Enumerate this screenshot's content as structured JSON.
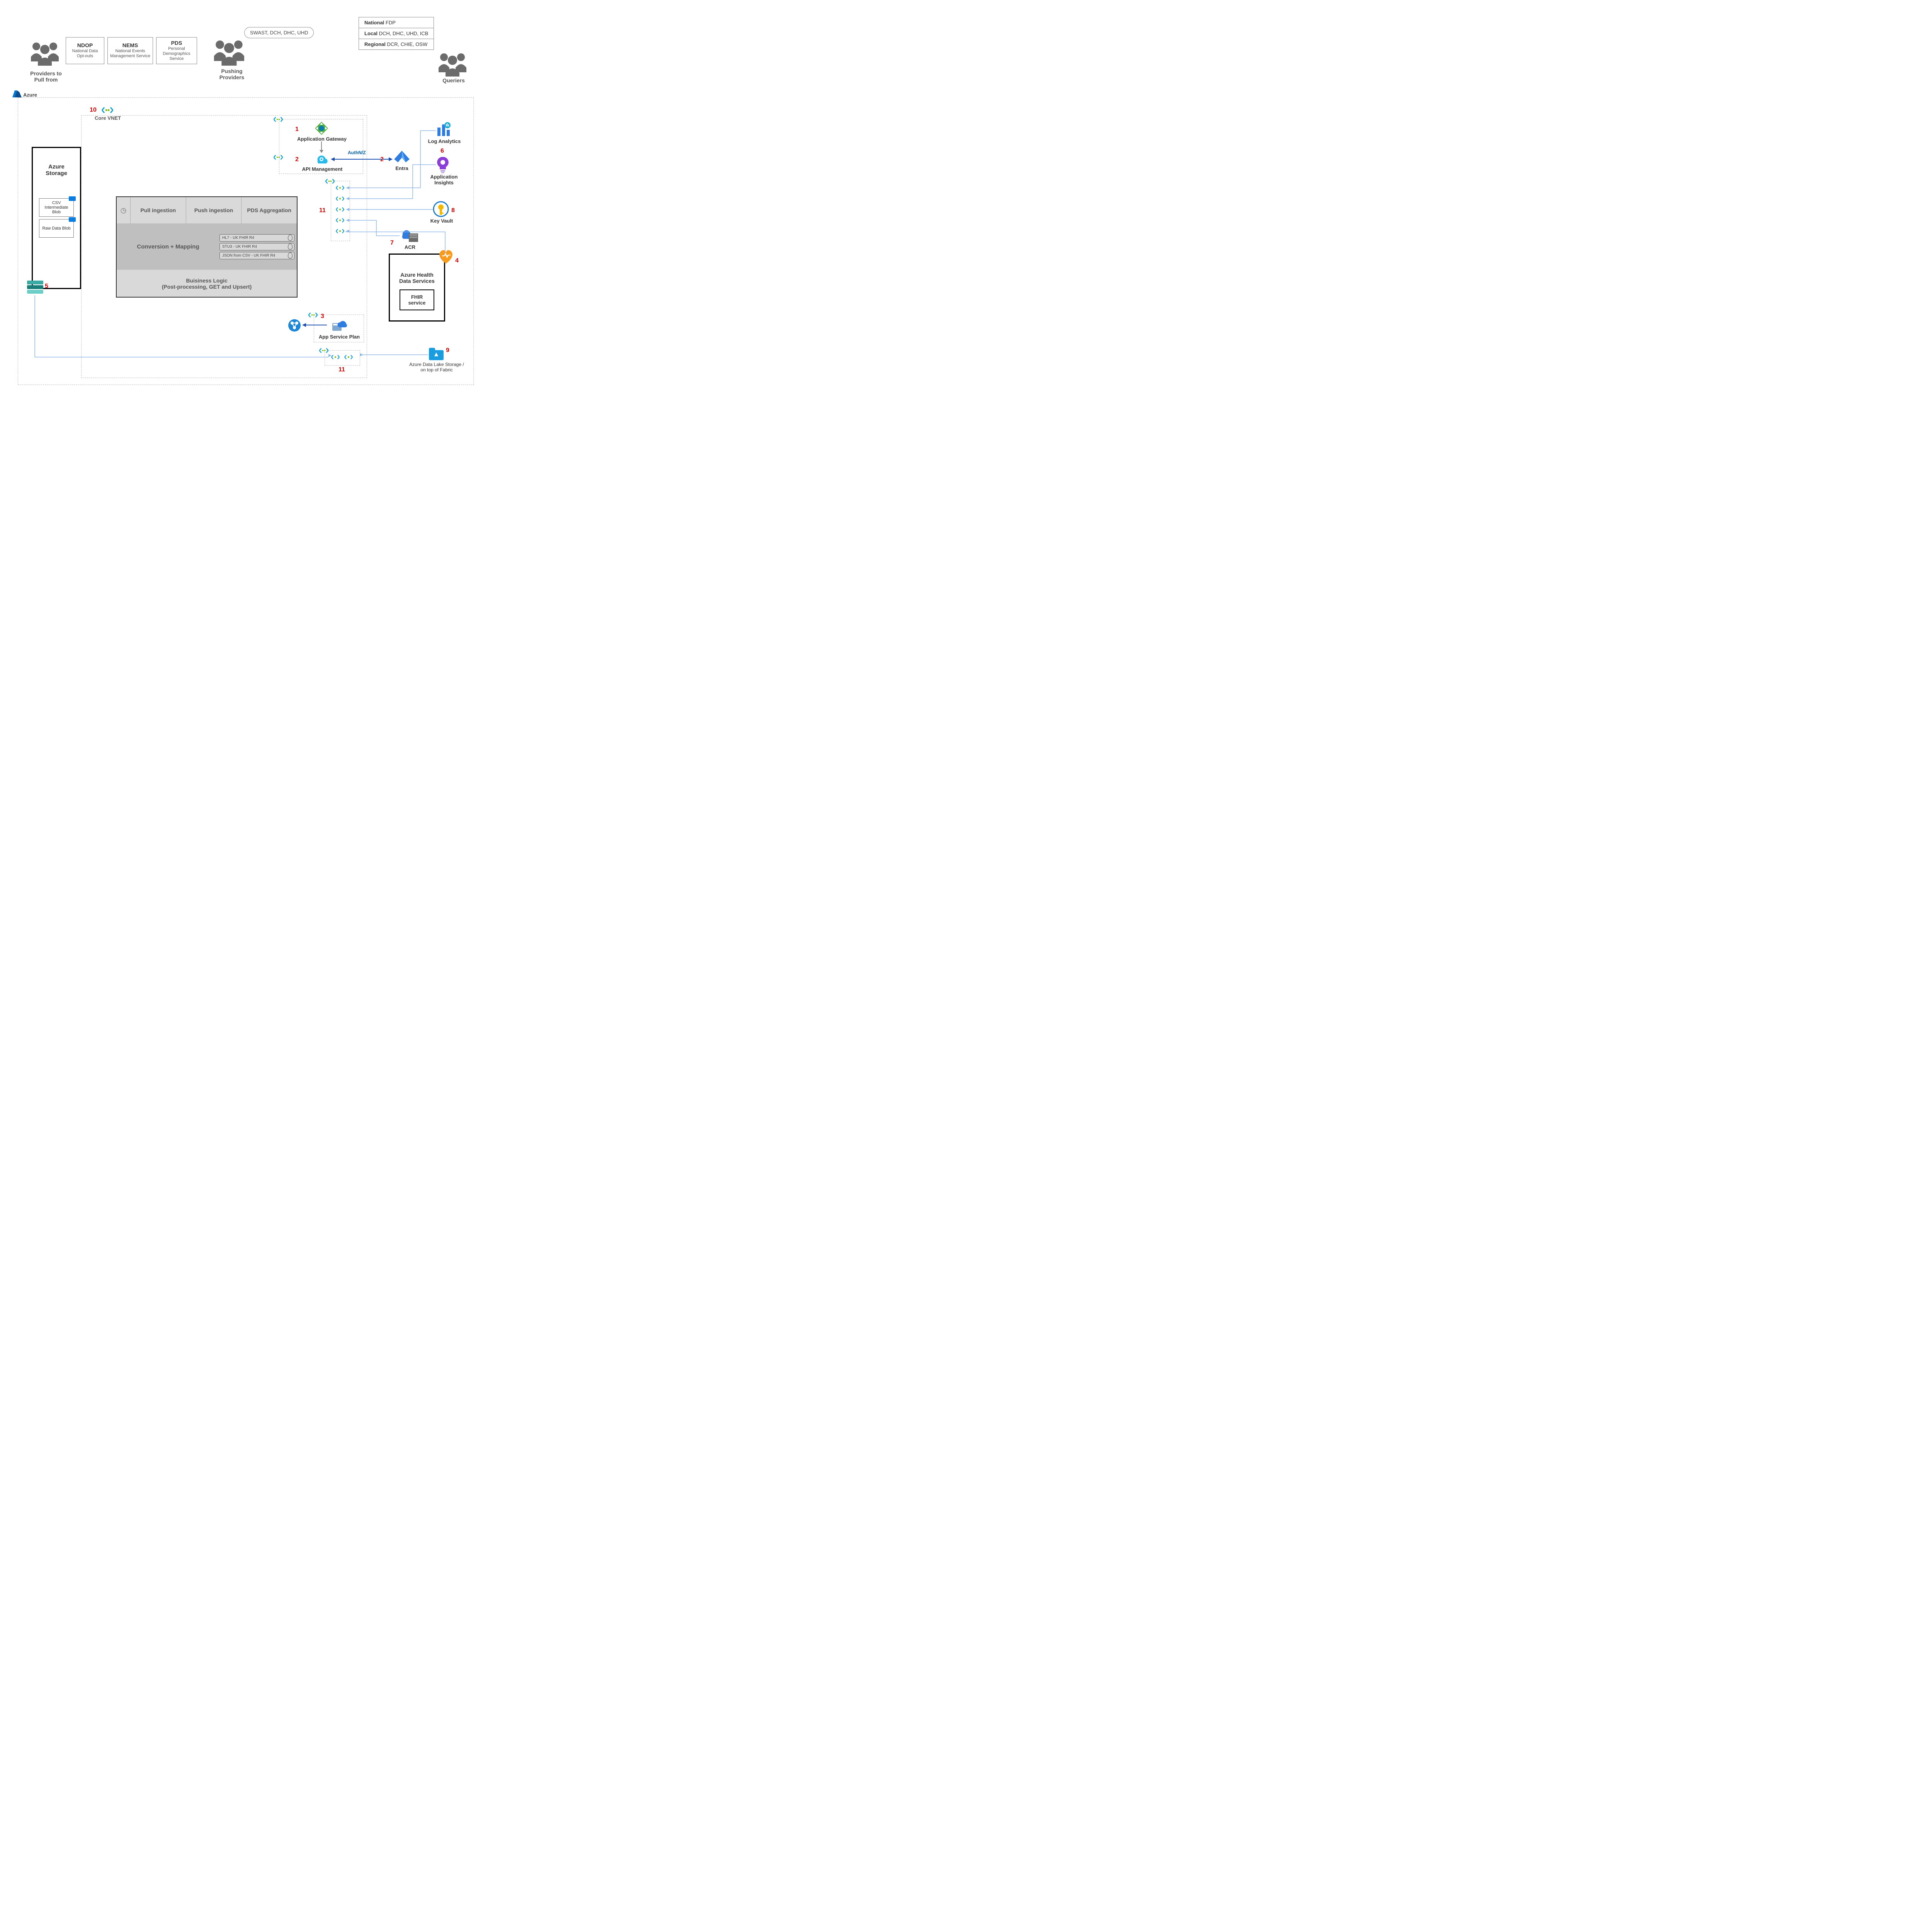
{
  "azure_label": "Azure",
  "top": {
    "providers_label": "Providers to Pull from",
    "ndop": {
      "title": "NDOP",
      "sub": "National Data Opt-outs"
    },
    "nems": {
      "title": "NEMS",
      "sub": "National Events Management Service"
    },
    "pds": {
      "title": "PDS",
      "sub": "Personal Demographics Service"
    },
    "pushing_label": "Pushing Providers",
    "pushing_pill": "SWAST, DCH, DHC, UHD",
    "queriers_label": "Queriers",
    "q_national_b": "National",
    "q_national": " FDP",
    "q_local_b": "Local",
    "q_local": " DCH, DHC, UHD, ICB",
    "q_regional_b": "Regional",
    "q_regional": " DCR, CHIE, OSW"
  },
  "sidebar": {
    "title": "Azure Storage",
    "csv_blob": "CSV Intermediate Blob",
    "raw_blob": "Raw Data Blob"
  },
  "vnet": {
    "core_label": "Core VNET"
  },
  "gateway": {
    "app_gateway": "Application Gateway",
    "api_mgmt": "API Management",
    "entra": "Entra",
    "authn": "AuthN/Z"
  },
  "func": {
    "tab_pull": "Pull ingestion",
    "tab_push": "Push ingestion",
    "tab_pds": "PDS Aggregation",
    "conv_title": "Conversion + Mapping",
    "pill1": "HL7 - UK FHIR R4",
    "pill2": "STU3 - UK FHIR R4",
    "pill3": "JSON from CSV - UK FHIR R4",
    "biz": "Buisiness Logic\n(Post-processing, GET and Upsert)"
  },
  "svc": {
    "log_analytics": "Log Analytics",
    "app_insights": "Application Insights",
    "key_vault": "Key Vault",
    "acr": "ACR",
    "ahds": "Azure Health Data Services",
    "fhir": "FHIR service",
    "app_service_plan": "App Service Plan",
    "adls": "Azure Data Lake Storage / on top of Fabric"
  },
  "numbers": {
    "n1": "1",
    "n2a": "2",
    "n2b": "2",
    "n3": "3",
    "n4": "4",
    "n5": "5",
    "n6": "6",
    "n7": "7",
    "n8": "8",
    "n9": "9",
    "n10": "10",
    "n11a": "11",
    "n11b": "11"
  }
}
